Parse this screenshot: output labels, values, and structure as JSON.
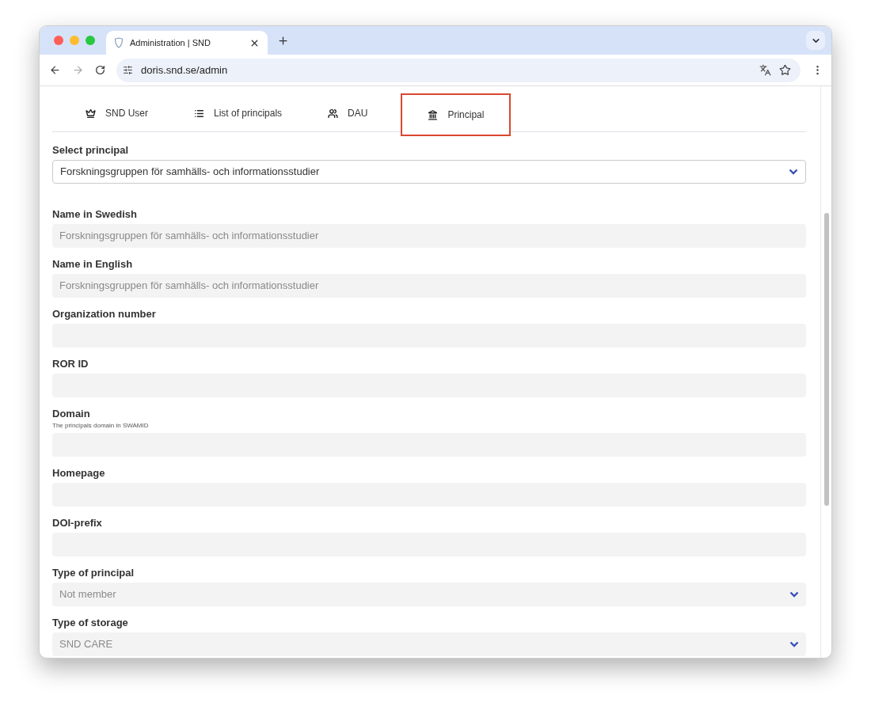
{
  "browser": {
    "tab_title": "Administration | SND",
    "url": "doris.snd.se/admin"
  },
  "tabs": [
    {
      "label": "SND User",
      "selected": false
    },
    {
      "label": "List of principals",
      "selected": false
    },
    {
      "label": "DAU",
      "selected": false
    },
    {
      "label": "Principal",
      "selected": true
    }
  ],
  "select_principal": {
    "label": "Select principal",
    "value": "Forskningsgruppen för samhälls- och informationsstudier"
  },
  "fields": [
    {
      "kind": "text",
      "label": "Name in Swedish",
      "value": "Forskningsgruppen för samhälls- och informationsstudier"
    },
    {
      "kind": "text",
      "label": "Name in English",
      "value": "Forskningsgruppen för samhälls- och informationsstudier"
    },
    {
      "kind": "text",
      "label": "Organization number"
    },
    {
      "kind": "text",
      "label": "ROR ID"
    },
    {
      "kind": "text",
      "label": "Domain",
      "hint": "The principals domain in SWAMID"
    },
    {
      "kind": "text",
      "label": "Homepage"
    },
    {
      "kind": "text",
      "label": "DOI-prefix"
    },
    {
      "kind": "select",
      "label": "Type of principal",
      "value": "Not member"
    },
    {
      "kind": "select",
      "label": "Type of storage",
      "value": "SND CARE"
    }
  ]
}
